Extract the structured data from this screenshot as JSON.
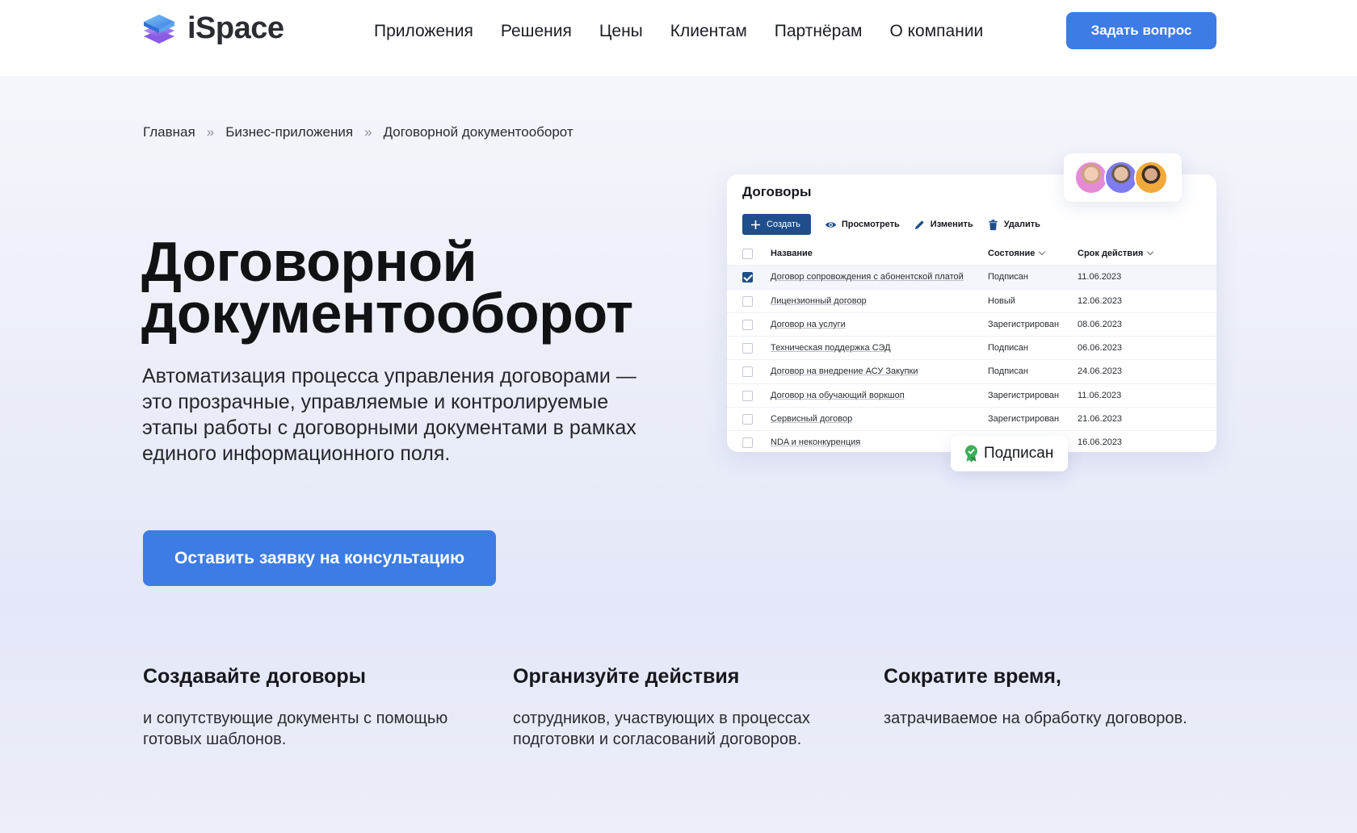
{
  "header": {
    "logo_text": "iSpace",
    "nav": [
      "Приложения",
      "Решения",
      "Цены",
      "Клиентам",
      "Партнёрам",
      "О компании"
    ],
    "ask_button": "Задать вопрос"
  },
  "breadcrumb": [
    "Главная",
    "Бизнес-приложения",
    "Договорной документооборот"
  ],
  "breadcrumb_separator": "»",
  "hero": {
    "title_line1": "Договорной",
    "title_line2": "документооборот",
    "subtitle": "Автоматизация процесса управления договорами — это прозрачные, управляемые и контролируемые этапы работы с договорными документами в рамках единого информационного поля.",
    "cta_button": "Оставить заявку на консультацию"
  },
  "app_card": {
    "title": "Договоры",
    "toolbar": {
      "create": "Создать",
      "view": "Просмотреть",
      "edit": "Изменить",
      "delete": "Удалить"
    },
    "columns": {
      "name": "Название",
      "state": "Состояние",
      "date": "Срок действия"
    },
    "rows": [
      {
        "name": "Договор сопровождения с абонентской платой",
        "state": "Подписан",
        "date": "11.06.2023",
        "checked": true
      },
      {
        "name": "Лицензионный договор",
        "state": "Новый",
        "date": "12.06.2023",
        "checked": false
      },
      {
        "name": "Договор на услуги",
        "state": "Зарегистрирован",
        "date": "08.06.2023",
        "checked": false
      },
      {
        "name": "Техническая поддержка СЭД",
        "state": "Подписан",
        "date": "06.06.2023",
        "checked": false
      },
      {
        "name": "Договор на внедрение АСУ Закупки",
        "state": "Подписан",
        "date": "24.06.2023",
        "checked": false
      },
      {
        "name": "Договор на обучающий воркшоп",
        "state": "Зарегистрирован",
        "date": "11.06.2023",
        "checked": false
      },
      {
        "name": "Сервисный договор",
        "state": "Зарегистрирован",
        "date": "21.06.2023",
        "checked": false
      },
      {
        "name": "NDA и неконкуренция",
        "state": "",
        "date": "16.06.2023",
        "checked": false
      }
    ],
    "status_badge": "Подписан"
  },
  "features": [
    {
      "title": "Создавайте договоры",
      "text": "и сопутствующие документы с помощью готовых шаблонов."
    },
    {
      "title": "Организуйте действия",
      "text": "сотрудников, участвующих в процессах подготовки и согласований договоров."
    },
    {
      "title": "Сократите время,",
      "text": "затрачиваемое на обработку договоров."
    }
  ],
  "colors": {
    "accent": "#3d7ce4",
    "dark_accent": "#1f4f8a",
    "badge_green": "#3fae5a"
  },
  "icons": [
    "logo-icon",
    "plus-icon",
    "eye-icon",
    "pencil-icon",
    "trash-icon",
    "chevron-down-icon",
    "certificate-icon"
  ]
}
